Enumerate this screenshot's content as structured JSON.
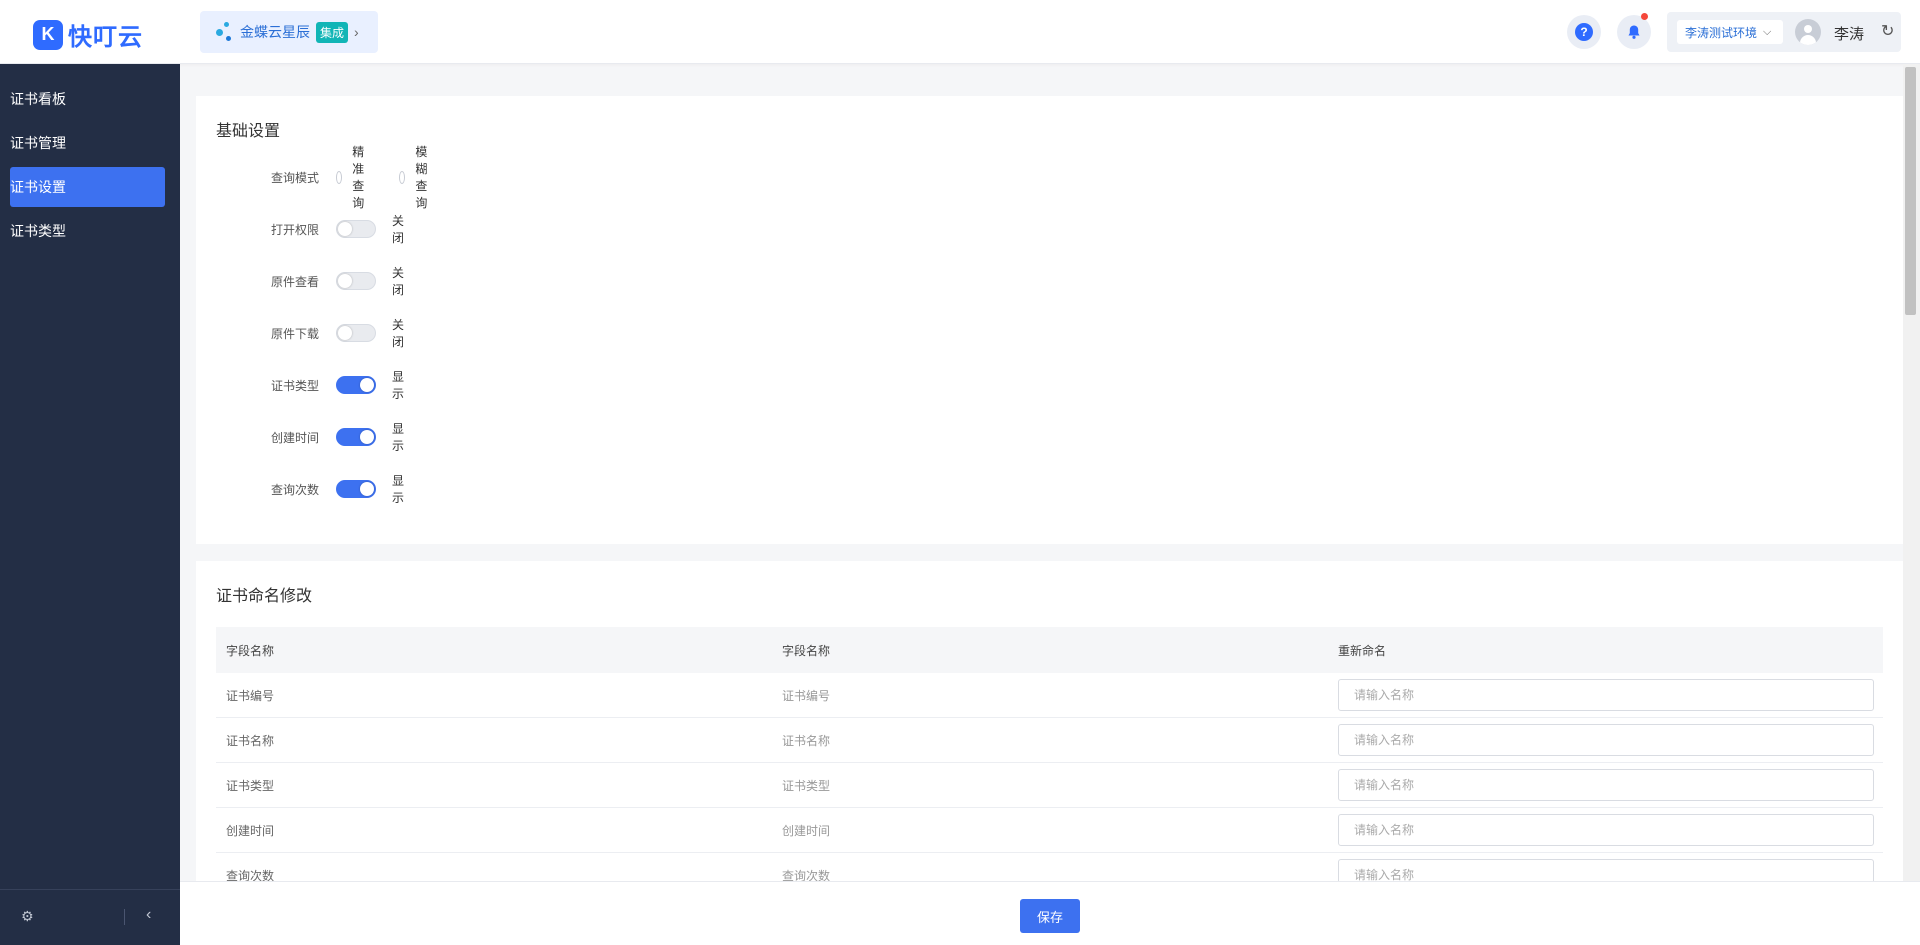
{
  "header": {
    "logo_mark": "K",
    "logo_text": "快叮云",
    "app_name": "金蝶云星辰",
    "app_badge": "集成",
    "help_symbol": "?",
    "environment": "李涛测试环境",
    "user_name": "李涛",
    "colors": {
      "brand": "#2f6bff",
      "badge": "#11b5b6",
      "notification_dot": "#f5473a"
    }
  },
  "sidebar": {
    "items": [
      {
        "label": "证书看板"
      },
      {
        "label": "证书管理"
      },
      {
        "label": "证书设置",
        "active": true
      },
      {
        "label": "证书类型"
      }
    ],
    "colors": {
      "background": "#232e45",
      "active": "#3d71f0"
    }
  },
  "basic_settings": {
    "title": "基础设置",
    "query_mode": {
      "label": "查询模式",
      "options": [
        "精准查询",
        "模糊查询"
      ],
      "selected": null
    },
    "switches": [
      {
        "label": "打开权限",
        "on": false,
        "state_text": "关闭"
      },
      {
        "label": "原件查看",
        "on": false,
        "state_text": "关闭"
      },
      {
        "label": "原件下载",
        "on": false,
        "state_text": "关闭"
      },
      {
        "label": "证书类型",
        "on": true,
        "state_text": "显示"
      },
      {
        "label": "创建时间",
        "on": true,
        "state_text": "显示"
      },
      {
        "label": "查询次数",
        "on": true,
        "state_text": "显示"
      }
    ]
  },
  "rename_section": {
    "title": "证书命名修改",
    "columns": [
      "字段名称",
      "字段名称",
      "重新命名"
    ],
    "rows": [
      {
        "field": "证书编号",
        "current": "证书编号",
        "value": "",
        "placeholder": "请输入名称"
      },
      {
        "field": "证书名称",
        "current": "证书名称",
        "value": "",
        "placeholder": "请输入名称"
      },
      {
        "field": "证书类型",
        "current": "证书类型",
        "value": "",
        "placeholder": "请输入名称"
      },
      {
        "field": "创建时间",
        "current": "创建时间",
        "value": "",
        "placeholder": "请输入名称"
      },
      {
        "field": "查询次数",
        "current": "查询次数",
        "value": "",
        "placeholder": "请输入名称"
      }
    ]
  },
  "footer": {
    "save_label": "保存"
  }
}
